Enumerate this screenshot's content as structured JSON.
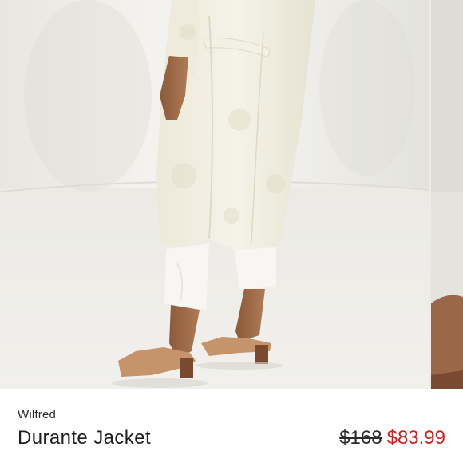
{
  "product": {
    "brand": "Wilfred",
    "name": "Durante Jacket",
    "original_price": "$168",
    "sale_price": "$83.99"
  },
  "colors": {
    "sale": "#d0211f",
    "text": "#1f1f1f",
    "background": "#ffffff"
  }
}
